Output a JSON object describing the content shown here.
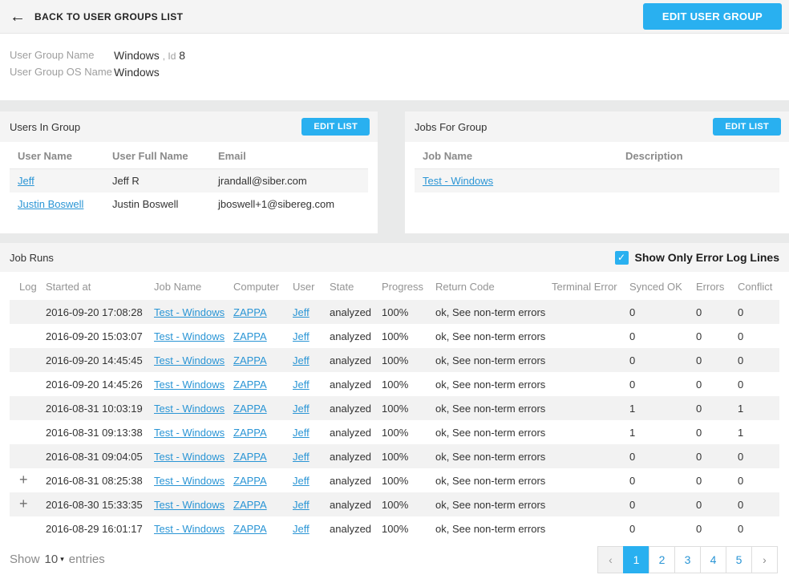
{
  "colors": {
    "accent_blue": "#29b0f0",
    "link_blue": "#2a95d5",
    "bar_gray": "#f4f4f4",
    "stripe_gray": "#f2f2f2"
  },
  "icons": {
    "back_arrow": "←",
    "expand_plus": "+",
    "checkbox_check": "✓",
    "dropdown_caret": "▾"
  },
  "topbar": {
    "back_label": "BACK TO USER GROUPS LIST",
    "edit_button_label": "EDIT USER GROUP"
  },
  "group_info": {
    "name_label": "User Group Name",
    "name_value": "Windows",
    "id_label": ", Id",
    "id_value": "8",
    "os_label": "User Group OS Name",
    "os_value": "Windows"
  },
  "users_panel": {
    "title": "Users In Group",
    "edit_list_label": "EDIT LIST",
    "columns": [
      "User Name",
      "User Full Name",
      "Email"
    ],
    "rows": [
      {
        "user_name": "Jeff",
        "full_name": "Jeff R",
        "email": "jrandall@siber.com"
      },
      {
        "user_name": "Justin Boswell",
        "full_name": "Justin Boswell",
        "email": "jboswell+1@sibereg.com"
      }
    ]
  },
  "jobs_panel": {
    "title": "Jobs For Group",
    "edit_list_label": "EDIT LIST",
    "columns": [
      "Job Name",
      "Description"
    ],
    "rows": [
      {
        "job_name": "Test - Windows",
        "description": ""
      }
    ]
  },
  "job_runs": {
    "title": "Job Runs",
    "filter_label": "Show Only Error Log Lines",
    "filter_checked": true,
    "columns": [
      "Log",
      "Started at",
      "Job Name",
      "Computer",
      "User",
      "State",
      "Progress",
      "Return Code",
      "Terminal Error",
      "Synced OK",
      "Errors",
      "Conflict"
    ],
    "rows": [
      {
        "expand": false,
        "started_at": "2016-09-20 17:08:28",
        "job_name": "Test - Windows",
        "computer": "ZAPPA",
        "user": "Jeff",
        "state": "analyzed",
        "progress": "100%",
        "return_code": "ok, See non-term errors",
        "terminal_error": "",
        "synced_ok": "0",
        "errors": "0",
        "conflict": "0"
      },
      {
        "expand": false,
        "started_at": "2016-09-20 15:03:07",
        "job_name": "Test - Windows",
        "computer": "ZAPPA",
        "user": "Jeff",
        "state": "analyzed",
        "progress": "100%",
        "return_code": "ok, See non-term errors",
        "terminal_error": "",
        "synced_ok": "0",
        "errors": "0",
        "conflict": "0"
      },
      {
        "expand": false,
        "started_at": "2016-09-20 14:45:45",
        "job_name": "Test - Windows",
        "computer": "ZAPPA",
        "user": "Jeff",
        "state": "analyzed",
        "progress": "100%",
        "return_code": "ok, See non-term errors",
        "terminal_error": "",
        "synced_ok": "0",
        "errors": "0",
        "conflict": "0"
      },
      {
        "expand": false,
        "started_at": "2016-09-20 14:45:26",
        "job_name": "Test - Windows",
        "computer": "ZAPPA",
        "user": "Jeff",
        "state": "analyzed",
        "progress": "100%",
        "return_code": "ok, See non-term errors",
        "terminal_error": "",
        "synced_ok": "0",
        "errors": "0",
        "conflict": "0"
      },
      {
        "expand": false,
        "started_at": "2016-08-31 10:03:19",
        "job_name": "Test - Windows",
        "computer": "ZAPPA",
        "user": "Jeff",
        "state": "analyzed",
        "progress": "100%",
        "return_code": "ok, See non-term errors",
        "terminal_error": "",
        "synced_ok": "1",
        "errors": "0",
        "conflict": "1"
      },
      {
        "expand": false,
        "started_at": "2016-08-31 09:13:38",
        "job_name": "Test - Windows",
        "computer": "ZAPPA",
        "user": "Jeff",
        "state": "analyzed",
        "progress": "100%",
        "return_code": "ok, See non-term errors",
        "terminal_error": "",
        "synced_ok": "1",
        "errors": "0",
        "conflict": "1"
      },
      {
        "expand": false,
        "started_at": "2016-08-31 09:04:05",
        "job_name": "Test - Windows",
        "computer": "ZAPPA",
        "user": "Jeff",
        "state": "analyzed",
        "progress": "100%",
        "return_code": "ok, See non-term errors",
        "terminal_error": "",
        "synced_ok": "0",
        "errors": "0",
        "conflict": "0"
      },
      {
        "expand": true,
        "started_at": "2016-08-31 08:25:38",
        "job_name": "Test - Windows",
        "computer": "ZAPPA",
        "user": "Jeff",
        "state": "analyzed",
        "progress": "100%",
        "return_code": "ok, See non-term errors",
        "terminal_error": "",
        "synced_ok": "0",
        "errors": "0",
        "conflict": "0"
      },
      {
        "expand": true,
        "started_at": "2016-08-30 15:33:35",
        "job_name": "Test - Windows",
        "computer": "ZAPPA",
        "user": "Jeff",
        "state": "analyzed",
        "progress": "100%",
        "return_code": "ok, See non-term errors",
        "terminal_error": "",
        "synced_ok": "0",
        "errors": "0",
        "conflict": "0"
      },
      {
        "expand": false,
        "started_at": "2016-08-29 16:01:17",
        "job_name": "Test - Windows",
        "computer": "ZAPPA",
        "user": "Jeff",
        "state": "analyzed",
        "progress": "100%",
        "return_code": "ok, See non-term errors",
        "terminal_error": "",
        "synced_ok": "0",
        "errors": "0",
        "conflict": "0"
      }
    ]
  },
  "footer": {
    "show_label": "Show",
    "entries_value": "10",
    "entries_suffix": "entries",
    "pages": [
      {
        "label": "‹",
        "class": "nav disabled"
      },
      {
        "label": "1",
        "class": "active"
      },
      {
        "label": "2",
        "class": ""
      },
      {
        "label": "3",
        "class": ""
      },
      {
        "label": "4",
        "class": ""
      },
      {
        "label": "5",
        "class": ""
      },
      {
        "label": "›",
        "class": "nav"
      }
    ]
  }
}
